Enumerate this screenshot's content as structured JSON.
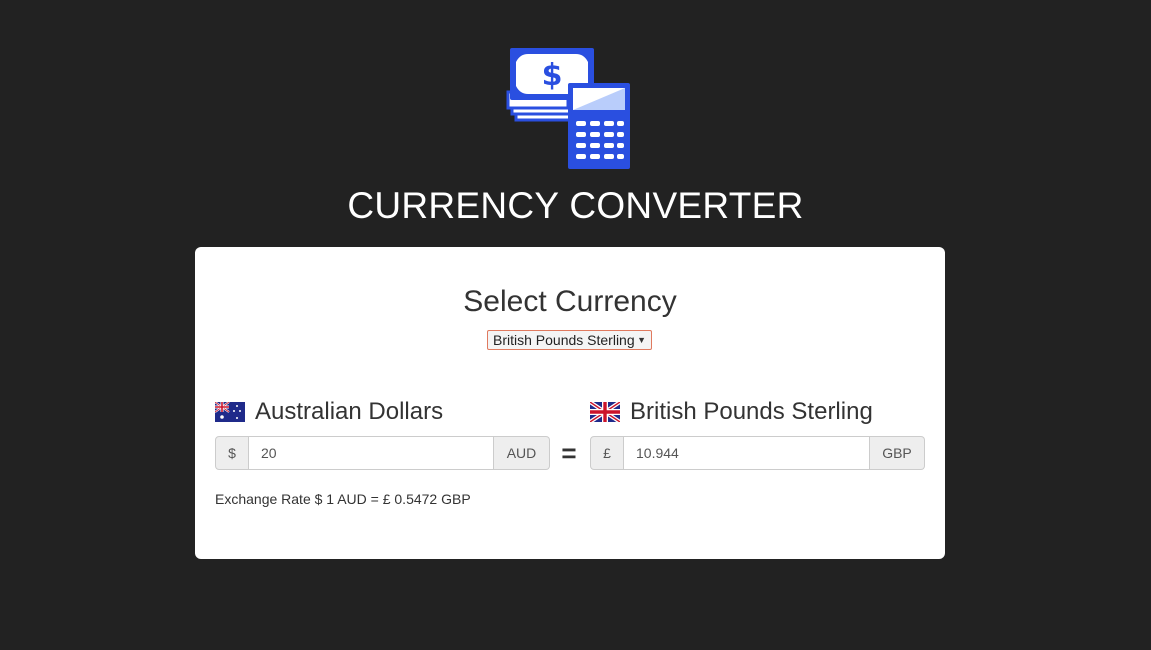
{
  "header": {
    "logo_icon": "money-calculator-icon",
    "title": "CURRENCY CONVERTER"
  },
  "selector": {
    "heading": "Select Currency",
    "selected": "British Pounds Sterling"
  },
  "from": {
    "name": "Australian Dollars",
    "flag_icon": "australia-flag-icon",
    "symbol": "$",
    "value": "20",
    "code": "AUD"
  },
  "equals": "=",
  "to": {
    "name": "British Pounds Sterling",
    "flag_icon": "uk-flag-icon",
    "symbol": "£",
    "value": "10.944",
    "code": "GBP"
  },
  "rate_text": "Exchange Rate $ 1 AUD = £ 0.5472 GBP",
  "colors": {
    "background": "#222222",
    "card": "#ffffff",
    "logo_blue": "#2a4fe0",
    "select_border": "#e07a5f"
  }
}
